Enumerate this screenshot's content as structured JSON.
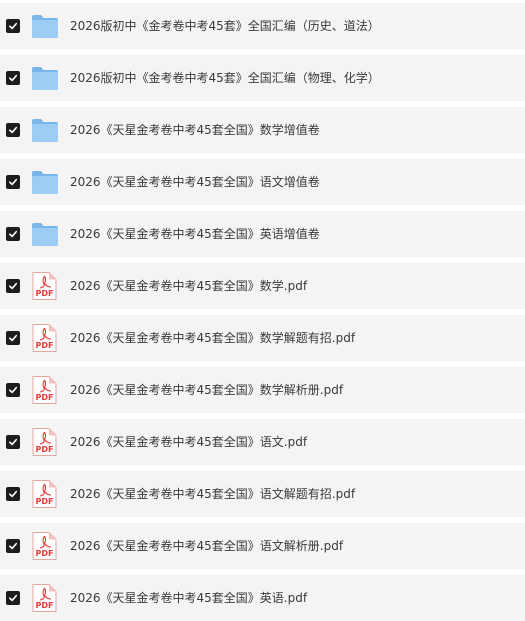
{
  "files": [
    {
      "name": "2026版初中《金考卷中考45套》全国汇编（历史、道法）",
      "type": "folder",
      "checked": true
    },
    {
      "name": "2026版初中《金考卷中考45套》全国汇编（物理、化学）",
      "type": "folder",
      "checked": true
    },
    {
      "name": "2026《天星金考卷中考45套全国》数学增值卷",
      "type": "folder",
      "checked": true
    },
    {
      "name": "2026《天星金考卷中考45套全国》语文增值卷",
      "type": "folder",
      "checked": true
    },
    {
      "name": "2026《天星金考卷中考45套全国》英语增值卷",
      "type": "folder",
      "checked": true
    },
    {
      "name": "2026《天星金考卷中考45套全国》数学.pdf",
      "type": "pdf",
      "checked": true
    },
    {
      "name": "2026《天星金考卷中考45套全国》数学解题有招.pdf",
      "type": "pdf",
      "checked": true
    },
    {
      "name": "2026《天星金考卷中考45套全国》数学解析册.pdf",
      "type": "pdf",
      "checked": true
    },
    {
      "name": "2026《天星金考卷中考45套全国》语文.pdf",
      "type": "pdf",
      "checked": true
    },
    {
      "name": "2026《天星金考卷中考45套全国》语文解题有招.pdf",
      "type": "pdf",
      "checked": true
    },
    {
      "name": "2026《天星金考卷中考45套全国》语文解析册.pdf",
      "type": "pdf",
      "checked": true
    },
    {
      "name": "2026《天星金考卷中考45套全国》英语.pdf",
      "type": "pdf",
      "checked": true
    }
  ],
  "icons": {
    "folder": "folder-icon",
    "pdf": "pdf-file-icon",
    "check": "checkmark-icon"
  },
  "pdf_label": "PDF",
  "colors": {
    "row_bg": "#f4f4f5",
    "checkbox": "#1d1d1f",
    "folder": "#8cc4f0",
    "pdf_red": "#e53935"
  }
}
